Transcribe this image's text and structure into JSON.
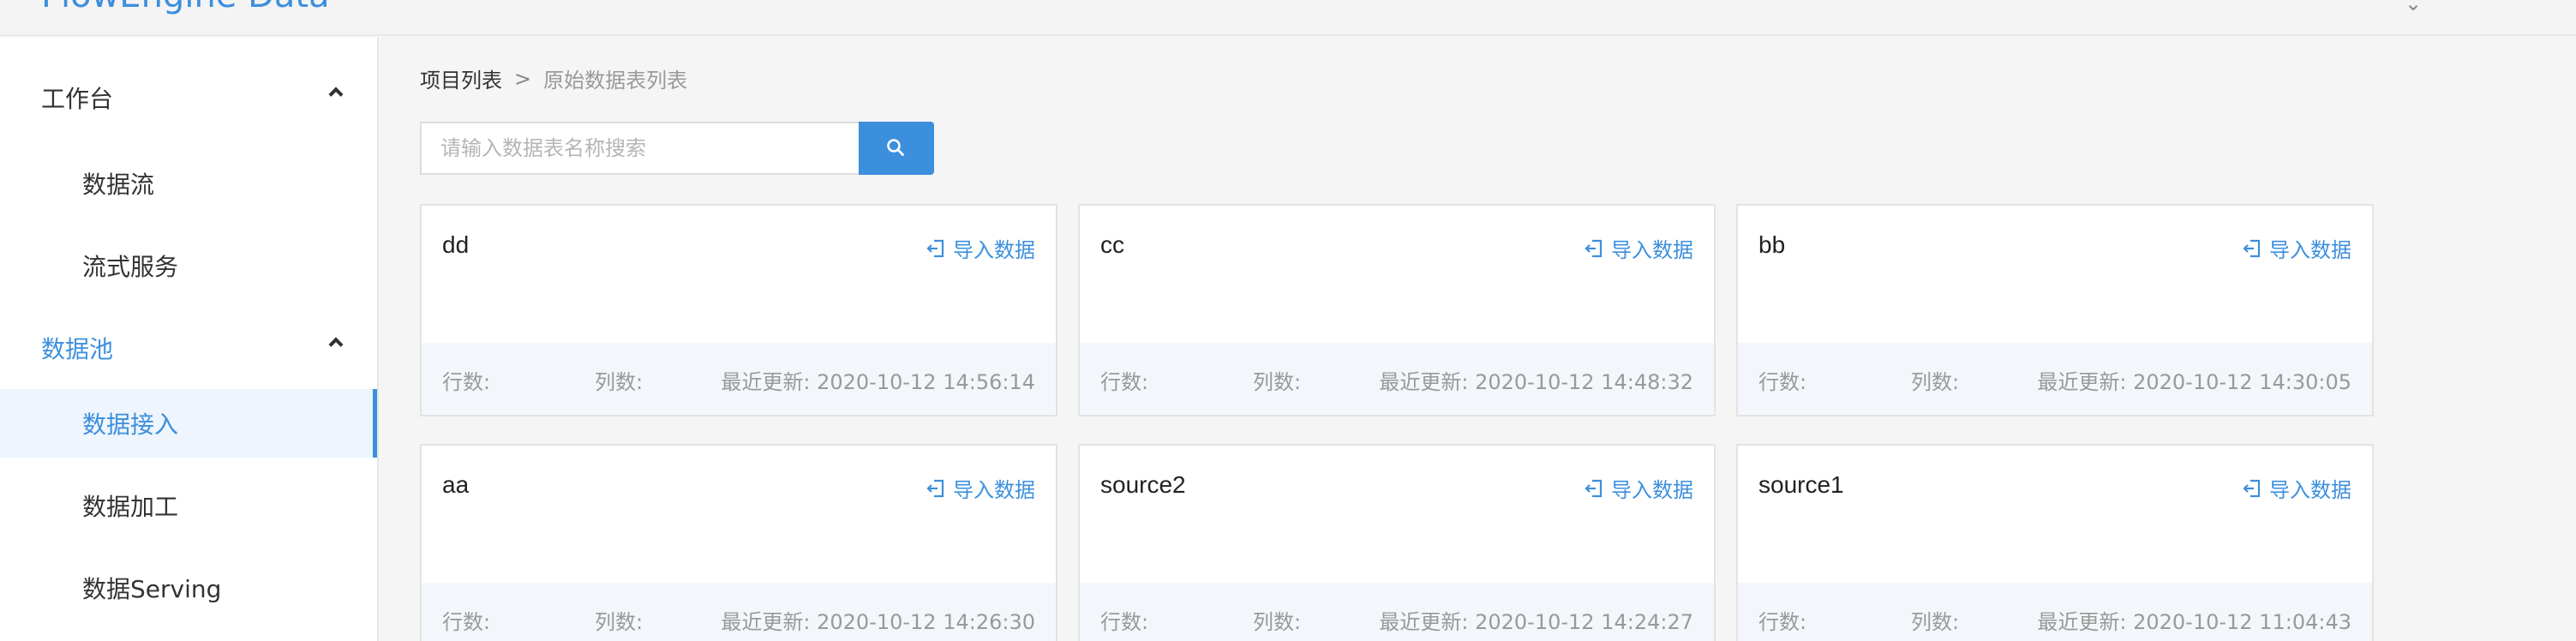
{
  "header": {
    "brand": "FlowEngine Data"
  },
  "sidebar": {
    "items": [
      {
        "label": "工作台",
        "type": "group"
      },
      {
        "label": "数据流",
        "type": "sub"
      },
      {
        "label": "流式服务",
        "type": "sub"
      },
      {
        "label": "数据池",
        "type": "group"
      },
      {
        "label": "数据接入",
        "type": "sub"
      },
      {
        "label": "数据加工",
        "type": "sub"
      },
      {
        "label": "数据Serving",
        "type": "sub"
      }
    ],
    "active_item": "数据接入",
    "active_group": "数据池"
  },
  "breadcrumb": {
    "root": "项目列表",
    "separator": ">",
    "current": "原始数据表列表"
  },
  "search": {
    "placeholder": "请输入数据表名称搜索",
    "value": ""
  },
  "cards": [
    {
      "name": "dd",
      "import_label": "导入数据",
      "rows_label": "行数:",
      "cols_label": "列数:",
      "updated": "最近更新: 2020-10-12 14:56:14"
    },
    {
      "name": "cc",
      "import_label": "导入数据",
      "rows_label": "行数:",
      "cols_label": "列数:",
      "updated": "最近更新: 2020-10-12 14:48:32"
    },
    {
      "name": "bb",
      "import_label": "导入数据",
      "rows_label": "行数:",
      "cols_label": "列数:",
      "updated": "最近更新: 2020-10-12 14:30:05"
    },
    {
      "name": "aa",
      "import_label": "导入数据",
      "rows_label": "行数:",
      "cols_label": "列数:",
      "updated": "最近更新: 2020-10-12 14:26:30"
    },
    {
      "name": "source2",
      "import_label": "导入数据",
      "rows_label": "行数:",
      "cols_label": "列数:",
      "updated": "最近更新: 2020-10-12 14:24:27"
    },
    {
      "name": "source1",
      "import_label": "导入数据",
      "rows_label": "行数:",
      "cols_label": "列数:",
      "updated": "最近更新: 2020-10-12 11:04:43"
    }
  ],
  "icons": {
    "search": "search-icon",
    "import": "import-icon",
    "collapse": "chevron-up-icon"
  },
  "colors": {
    "accent": "#3c8fdd",
    "sidebar_active_bg": "#eef5fc",
    "card_footer_bg": "#f3f7fb",
    "page_bg": "#f5f5f6"
  }
}
